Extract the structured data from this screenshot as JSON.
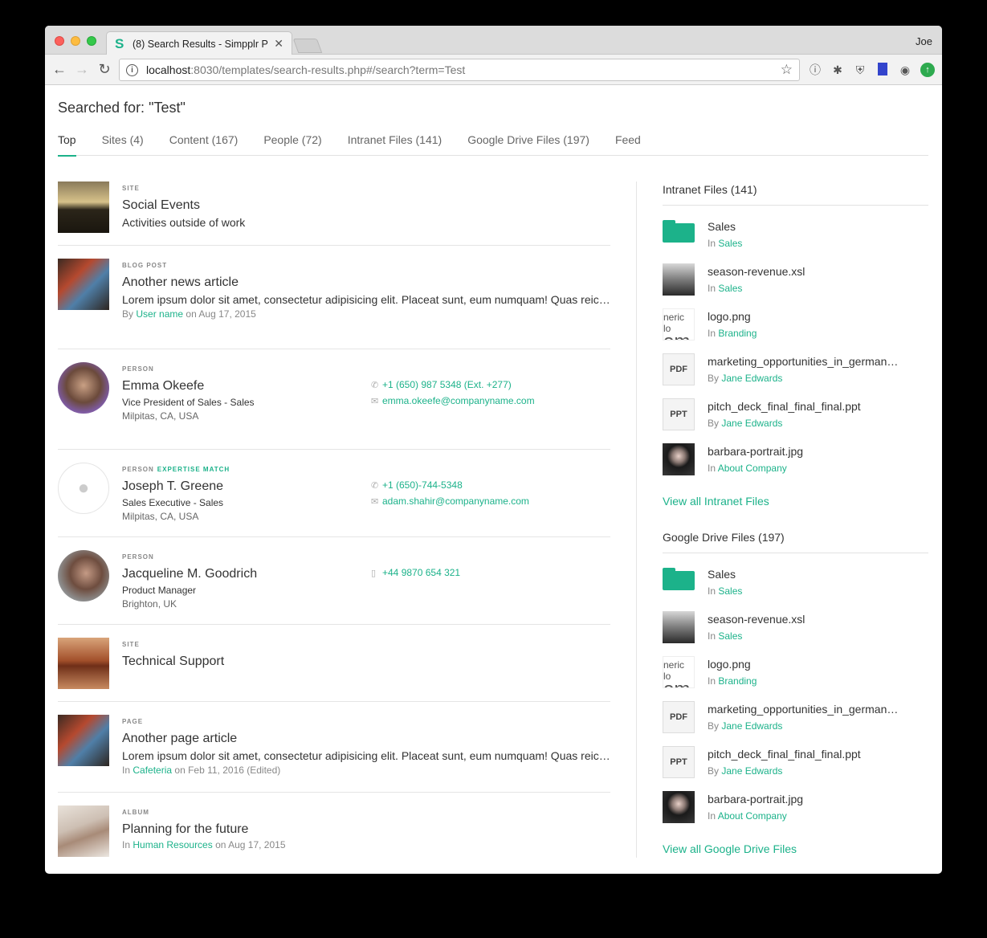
{
  "browser": {
    "tab_title": "(8) Search Results - Simpplr P",
    "user": "Joe",
    "url_host": "localhost",
    "url_rest": ":8030/templates/search-results.php#/search?term=Test"
  },
  "search": {
    "title": "Searched for: \"Test\"",
    "tabs": [
      "Top",
      "Sites (4)",
      "Content (167)",
      "People (72)",
      "Intranet Files (141)",
      "Google Drive Files (197)",
      "Feed"
    ]
  },
  "results": [
    {
      "kind": "SITE",
      "title": "Social Events",
      "sub": "Activities outside of work"
    },
    {
      "kind": "BLOG POST",
      "title": "Another news article",
      "sub": "Lorem ipsum dolor sit amet, consectetur adipisicing elit. Placeat sunt, eum numquam! Quas reiciendis",
      "meta_pre": "By",
      "meta_link": "User name",
      "meta_post": "on Aug 17, 2015"
    },
    {
      "kind": "PERSON",
      "title": "Emma Okeefe",
      "role": "Vice President of Sales - Sales",
      "location": "Milpitas, CA, USA",
      "phone": "+1 (650) 987 5348 (Ext. +277)",
      "email": "emma.okeefe@companyname.com"
    },
    {
      "kind": "PERSON",
      "match": "EXPERTISE MATCH",
      "title": "Joseph T. Greene",
      "role": "Sales Executive - Sales",
      "location": "Milpitas, CA, USA",
      "phone": "+1 (650)-744-5348",
      "email": "adam.shahir@companyname.com"
    },
    {
      "kind": "PERSON",
      "title": "Jacqueline M. Goodrich",
      "role": "Product Manager",
      "location": "Brighton, UK",
      "mobile": "+44 9870 654 321"
    },
    {
      "kind": "SITE",
      "title": "Technical Support"
    },
    {
      "kind": "PAGE",
      "title": "Another page article",
      "sub": "Lorem ipsum dolor sit amet, consectetur adipisicing elit. Placeat sunt, eum numquam! Quas reiciendis",
      "meta_pre": "In",
      "meta_link": "Cafeteria",
      "meta_post": "on Feb 11, 2016 (Edited)"
    },
    {
      "kind": "ALBUM",
      "title": "Planning for the future",
      "meta_pre": "In",
      "meta_link": "Human Resources",
      "meta_post": "on Aug 17, 2015"
    }
  ],
  "sidebar": {
    "intranet": {
      "heading": "Intranet Files (141)",
      "view_all": "View all Intranet Files",
      "files": [
        {
          "name": "Sales",
          "pre": "In",
          "link": "Sales"
        },
        {
          "name": "season-revenue.xsl",
          "pre": "In",
          "link": "Sales"
        },
        {
          "name": "logo.png",
          "pre": "In",
          "link": "Branding",
          "logo_text": "neric lo",
          "logo_big": "om"
        },
        {
          "name": "marketing_opportunities_in_germany.pdf",
          "pre": "By",
          "link": "Jane Edwards",
          "badge": "PDF"
        },
        {
          "name": "pitch_deck_final_final_final.ppt",
          "pre": "By",
          "link": "Jane Edwards",
          "badge": "PPT"
        },
        {
          "name": "barbara-portrait.jpg",
          "pre": "In",
          "link": "About Company"
        }
      ]
    },
    "drive": {
      "heading": "Google Drive Files (197)",
      "view_all": "View all Google Drive Files",
      "files": [
        {
          "name": "Sales",
          "pre": "In",
          "link": "Sales"
        },
        {
          "name": "season-revenue.xsl",
          "pre": "In",
          "link": "Sales"
        },
        {
          "name": "logo.png",
          "pre": "In",
          "link": "Branding",
          "logo_text": "neric lo",
          "logo_big": "om"
        },
        {
          "name": "marketing_opportunities_in_germany.pdf",
          "pre": "By",
          "link": "Jane Edwards",
          "badge": "PDF"
        },
        {
          "name": "pitch_deck_final_final_final.ppt",
          "pre": "By",
          "link": "Jane Edwards",
          "badge": "PPT"
        },
        {
          "name": "barbara-portrait.jpg",
          "pre": "In",
          "link": "About Company"
        }
      ]
    }
  },
  "colors": {
    "accent": "#1cb28a"
  }
}
